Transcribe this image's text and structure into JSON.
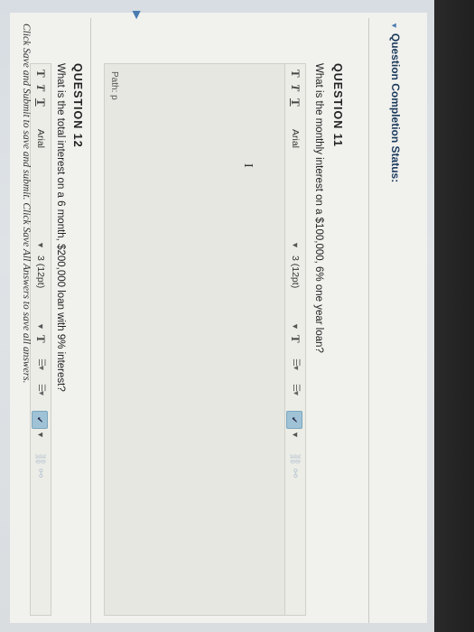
{
  "status_heading": "Question Completion Status:",
  "questions": [
    {
      "title": "QUESTION 11",
      "text": "What is the monthly interest on a $100,000, 6% one year loan?",
      "path_label": "Path: p"
    },
    {
      "title": "QUESTION 12",
      "text": "What is the total interest on a 6 month, $200,000 loan with 9% interest?"
    }
  ],
  "toolbar": {
    "bold": "T",
    "italic": "T",
    "underline": "T",
    "font": "Arial",
    "size": "3 (12pt)",
    "text_color": "T"
  },
  "footer_text": "Click Save and Submit to save and submit. Click Save All Answers to save all answers.",
  "icons": [
    "collapse-triangle-icon",
    "chevron-down-icon",
    "bullet-list-icon",
    "numbered-list-icon",
    "spellcheck-icon",
    "link-icon",
    "unlink-icon",
    "text-cursor-icon",
    "current-question-arrow-icon"
  ],
  "colors": {
    "accent": "#4a7bb0",
    "heading": "#1b3a5c",
    "editor_bg": "#e6e7e0"
  }
}
